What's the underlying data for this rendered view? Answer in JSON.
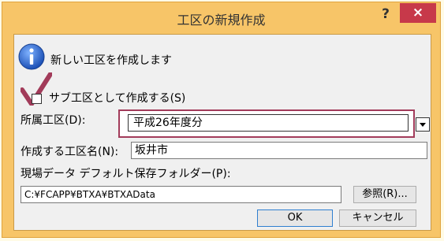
{
  "window": {
    "title": "工区の新規作成",
    "help_label": "?",
    "close_label": "×"
  },
  "info": {
    "message": "新しい工区を作成します"
  },
  "sub_area_checkbox": {
    "label": "サブ工区として作成する(S)",
    "checked": true
  },
  "parent_area": {
    "label": "所属工区(D):",
    "value": "平成26年度分"
  },
  "area_name": {
    "label": "作成する工区名(N):",
    "value": "坂井市"
  },
  "folder": {
    "label": "現場データ デフォルト保存フォルダー(P):",
    "value": "C:¥FCAPP¥BTXA¥BTXAData",
    "browse_label": "参照(R)..."
  },
  "buttons": {
    "ok_label": "OK",
    "cancel_label": "キャンセル"
  },
  "colors": {
    "accent": "#a23b5a",
    "close": "#c7394a",
    "frame": "#f7c568"
  }
}
